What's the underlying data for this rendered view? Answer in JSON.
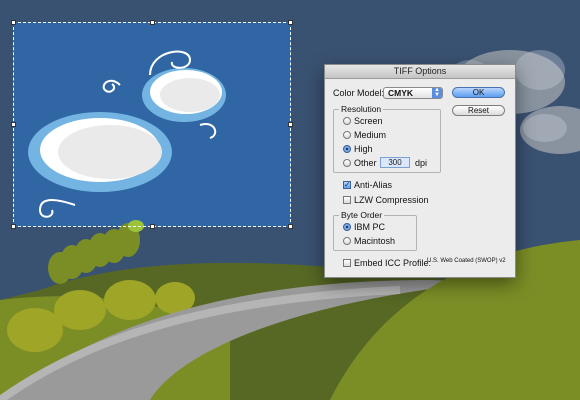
{
  "dialog": {
    "title": "TIFF Options",
    "color_model_label": "Color Model:",
    "color_model_value": "CMYK",
    "ok_label": "OK",
    "reset_label": "Reset",
    "resolution": {
      "title": "Resolution",
      "options": [
        "Screen",
        "Medium",
        "High",
        "Other"
      ],
      "selected": "High",
      "other_value": "300",
      "unit": "dpi"
    },
    "anti_alias": {
      "label": "Anti-Alias",
      "checked": true
    },
    "lzw": {
      "label": "LZW Compression",
      "checked": false
    },
    "byte_order": {
      "title": "Byte Order",
      "options": [
        "IBM PC",
        "Macintosh"
      ],
      "selected": "IBM PC"
    },
    "embed_icc": {
      "label": "Embed ICC Profile:",
      "checked": false,
      "profile": "U.S. Web Coated (SWOP) v2"
    }
  },
  "colors": {
    "sky": "#3a5272",
    "artboard": "#2f66a3",
    "hill": "#7b8e26",
    "road": "#9a9a9a",
    "button_blue": "#5d9ef2"
  }
}
